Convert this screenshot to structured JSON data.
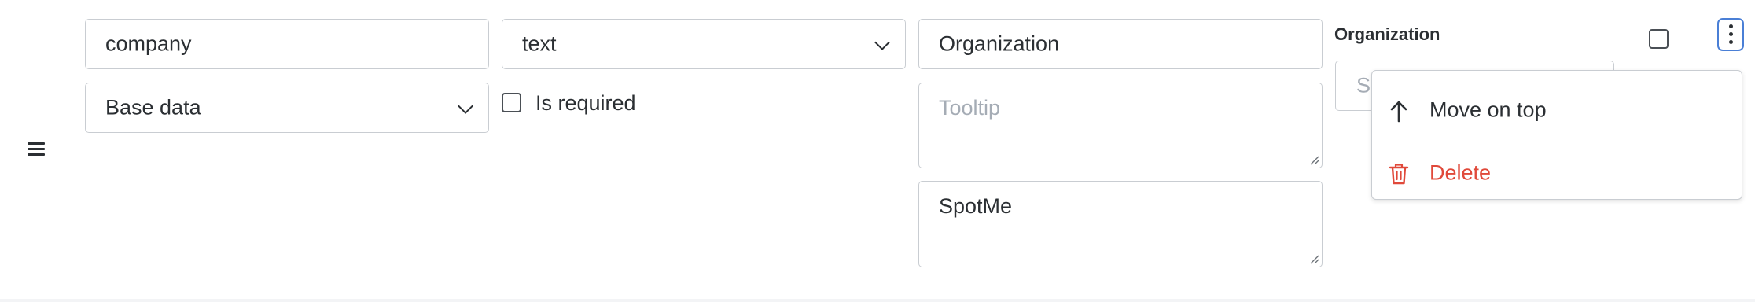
{
  "row": {
    "key_field": {
      "value": "company"
    },
    "type_select": {
      "selected": "text"
    },
    "label_field": {
      "value": "Organization"
    },
    "group_select": {
      "selected": "Base data"
    },
    "required_checkbox": {
      "label": "Is required",
      "checked": false
    },
    "tooltip_field": {
      "placeholder": "Tooltip",
      "value": ""
    },
    "default_field": {
      "value": "SpotMe"
    },
    "preview": {
      "title": "Organization",
      "input_placeholder_fragment": "S"
    },
    "visible_checkbox": {
      "checked": false
    }
  },
  "actions_menu": {
    "items": [
      {
        "label": "Move on top",
        "icon": "arrow-up-icon"
      },
      {
        "label": "Delete",
        "icon": "trash-icon"
      }
    ]
  },
  "colors": {
    "danger": "#e0493a",
    "focus": "#4a7fd6",
    "border": "#c9cdd2",
    "placeholder": "#a5acb5"
  }
}
